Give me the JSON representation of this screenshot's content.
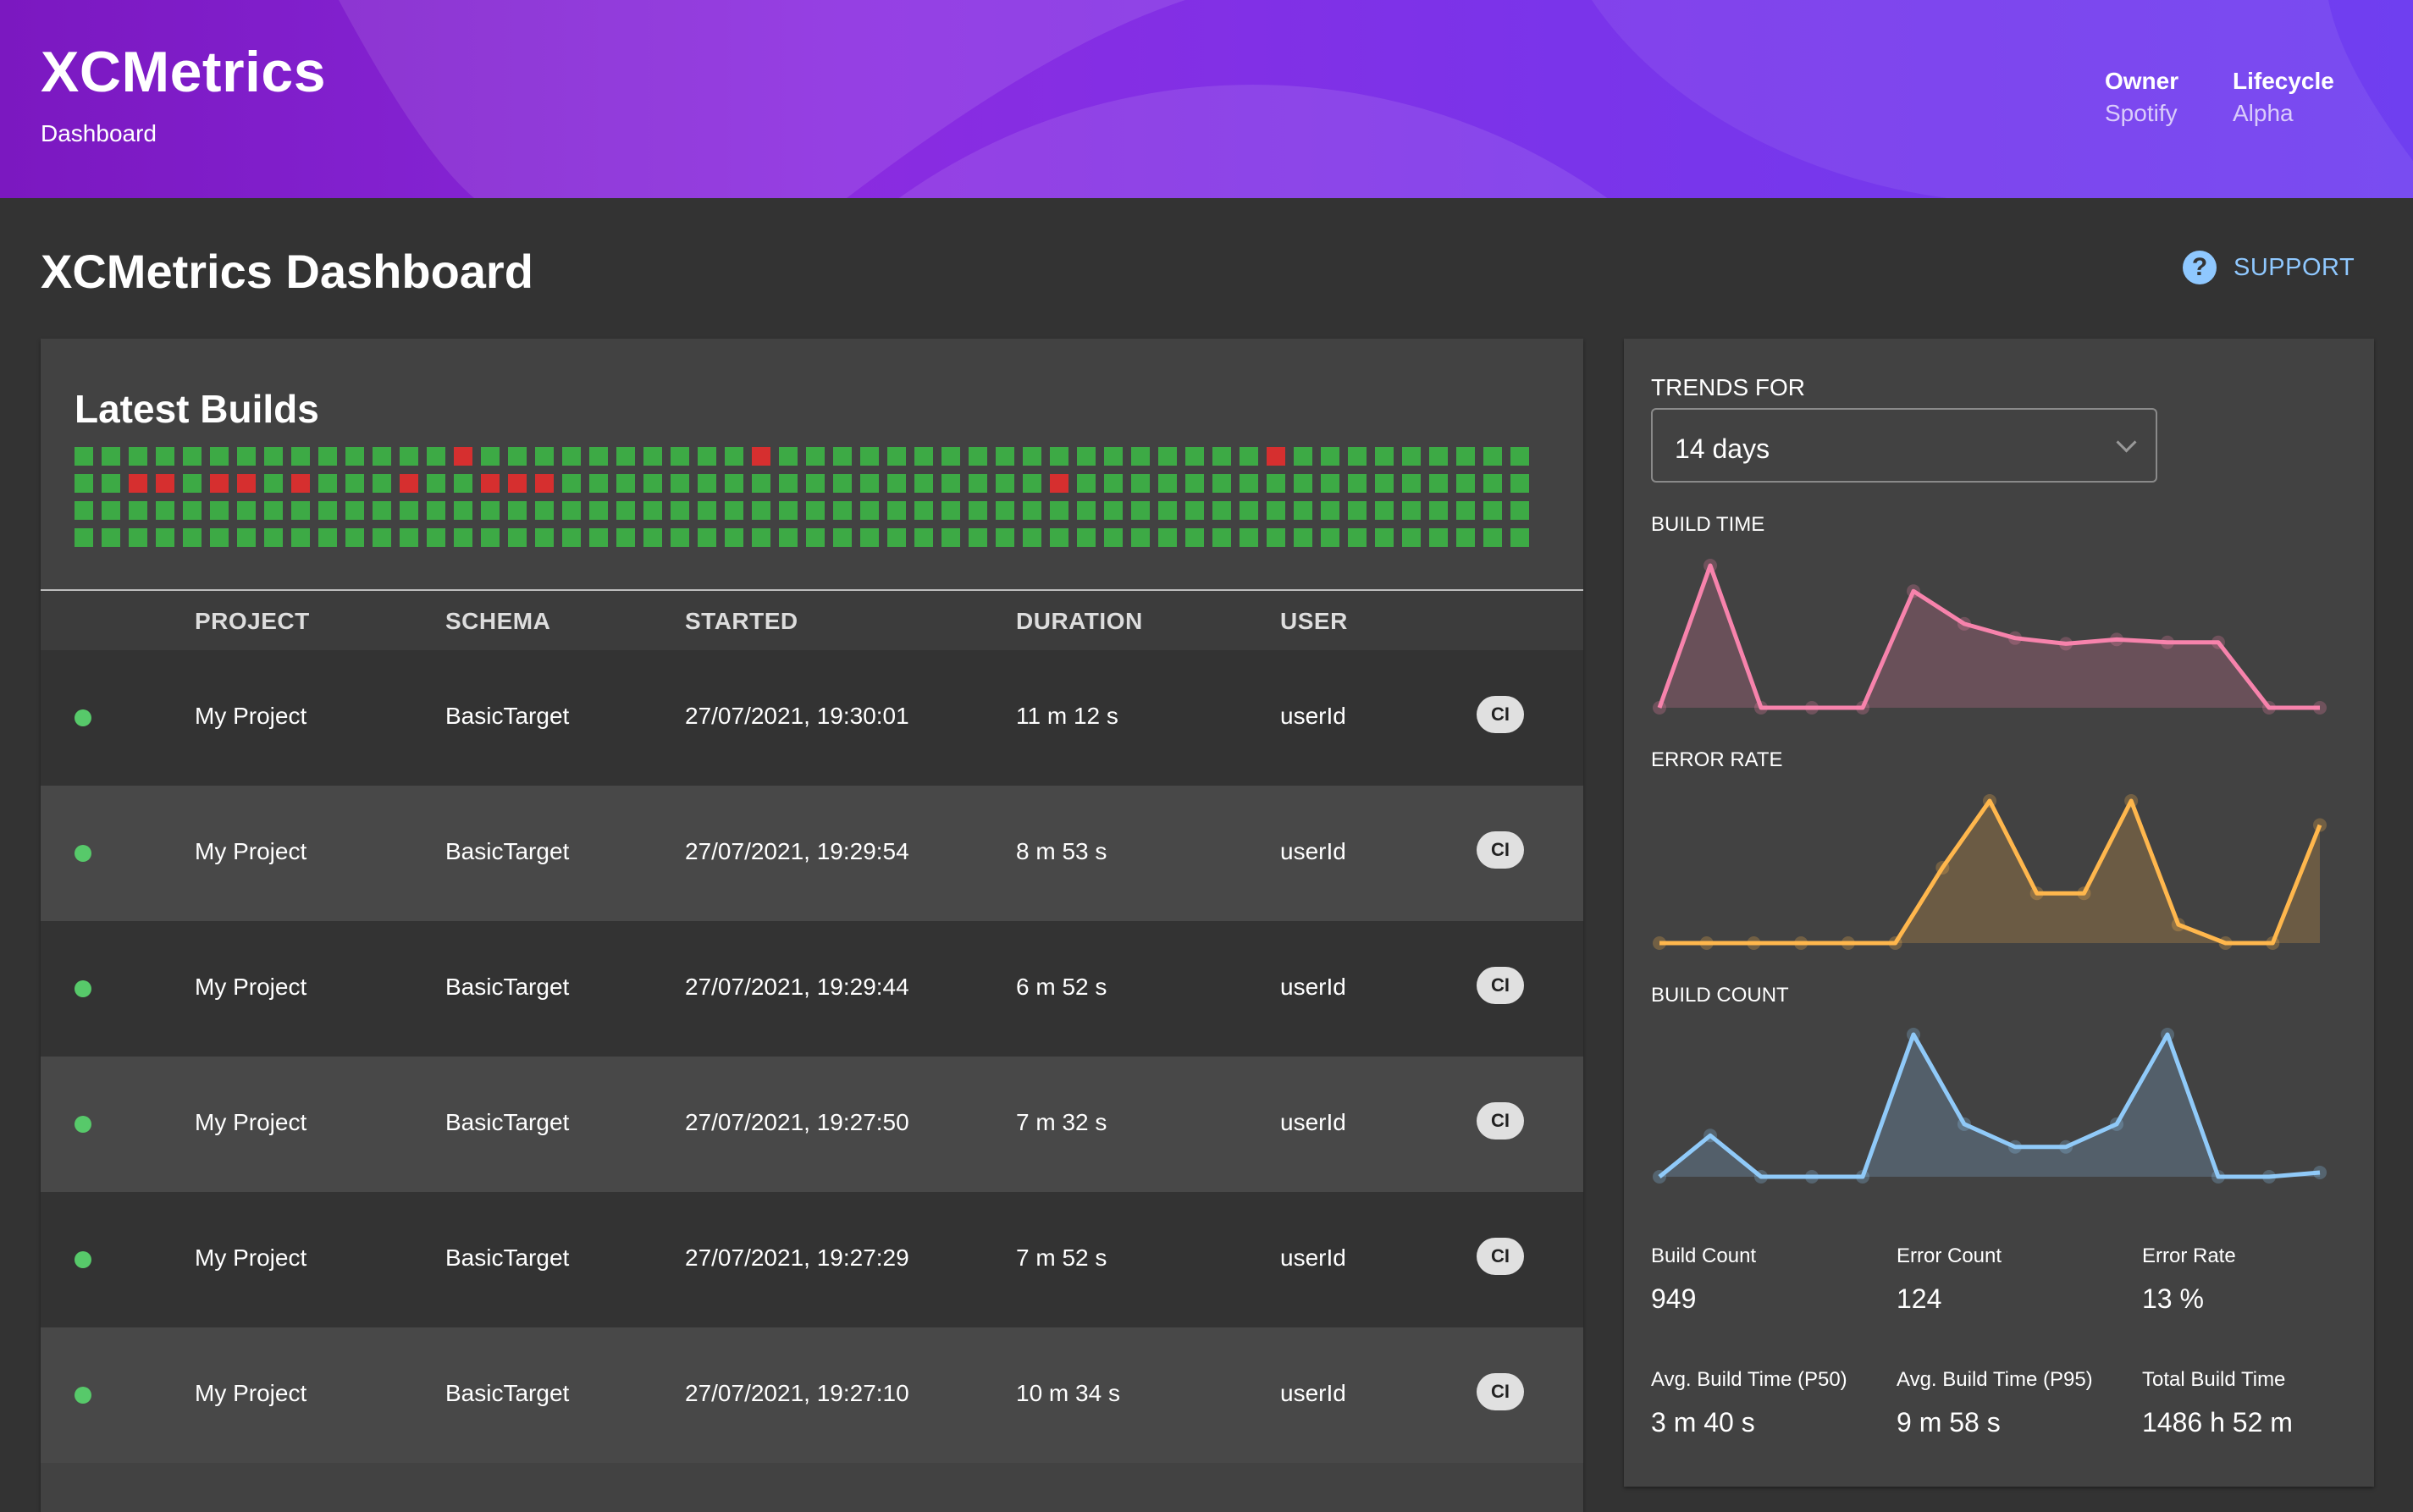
{
  "header": {
    "title": "XCMetrics",
    "subtitle": "Dashboard",
    "owner_label": "Owner",
    "owner_value": "Spotify",
    "lifecycle_label": "Lifecycle",
    "lifecycle_value": "Alpha"
  },
  "page": {
    "title": "XCMetrics Dashboard",
    "support_label": "SUPPORT",
    "support_icon": "question-circle-icon"
  },
  "builds": {
    "title": "Latest Builds",
    "heatmap": {
      "rows": 4,
      "cols": 54,
      "errors": [
        [
          0,
          14
        ],
        [
          0,
          25
        ],
        [
          0,
          44
        ],
        [
          1,
          2
        ],
        [
          1,
          3
        ],
        [
          1,
          5
        ],
        [
          1,
          6
        ],
        [
          1,
          8
        ],
        [
          1,
          12
        ],
        [
          1,
          15
        ],
        [
          1,
          16
        ],
        [
          1,
          17
        ],
        [
          1,
          36
        ]
      ]
    },
    "columns": [
      "PROJECT",
      "SCHEMA",
      "STARTED",
      "DURATION",
      "USER"
    ],
    "rows": [
      {
        "project": "My Project",
        "schema": "BasicTarget",
        "started": "27/07/2021, 19:30:01",
        "duration": "11 m 12 s",
        "user": "userId",
        "tag": "CI"
      },
      {
        "project": "My Project",
        "schema": "BasicTarget",
        "started": "27/07/2021, 19:29:54",
        "duration": "8 m 53 s",
        "user": "userId",
        "tag": "CI"
      },
      {
        "project": "My Project",
        "schema": "BasicTarget",
        "started": "27/07/2021, 19:29:44",
        "duration": "6 m 52 s",
        "user": "userId",
        "tag": "CI"
      },
      {
        "project": "My Project",
        "schema": "BasicTarget",
        "started": "27/07/2021, 19:27:50",
        "duration": "7 m 32 s",
        "user": "userId",
        "tag": "CI"
      },
      {
        "project": "My Project",
        "schema": "BasicTarget",
        "started": "27/07/2021, 19:27:29",
        "duration": "7 m 52 s",
        "user": "userId",
        "tag": "CI"
      },
      {
        "project": "My Project",
        "schema": "BasicTarget",
        "started": "27/07/2021, 19:27:10",
        "duration": "10 m 34 s",
        "user": "userId",
        "tag": "CI"
      }
    ],
    "status_color": "#57c96a",
    "success_color": "#3daa45",
    "error_color": "#d62f2f"
  },
  "trends": {
    "label": "TRENDS FOR",
    "period": "14 days",
    "charts": [
      {
        "label": "BUILD TIME",
        "color": "#f783ac",
        "values": [
          0,
          100,
          0,
          0,
          0,
          82,
          59,
          49,
          45,
          48,
          46,
          46,
          0,
          0
        ]
      },
      {
        "label": "ERROR RATE",
        "color": "#ffb74d",
        "values": [
          0,
          0,
          0,
          0,
          0,
          0,
          53,
          100,
          35,
          35,
          100,
          13,
          0,
          0,
          83
        ]
      },
      {
        "label": "BUILD COUNT",
        "color": "#90caf9",
        "values": [
          0,
          29,
          0,
          0,
          0,
          100,
          37,
          21,
          21,
          37,
          100,
          0,
          0,
          3
        ]
      }
    ],
    "stats": [
      {
        "label": "Build Count",
        "value": "949"
      },
      {
        "label": "Error Count",
        "value": "124"
      },
      {
        "label": "Error Rate",
        "value": "13 %"
      },
      {
        "label": "Avg. Build Time (P50)",
        "value": "3 m 40 s"
      },
      {
        "label": "Avg. Build Time (P95)",
        "value": "9 m 58 s"
      },
      {
        "label": "Total Build Time",
        "value": "1486 h 52 m"
      }
    ]
  }
}
